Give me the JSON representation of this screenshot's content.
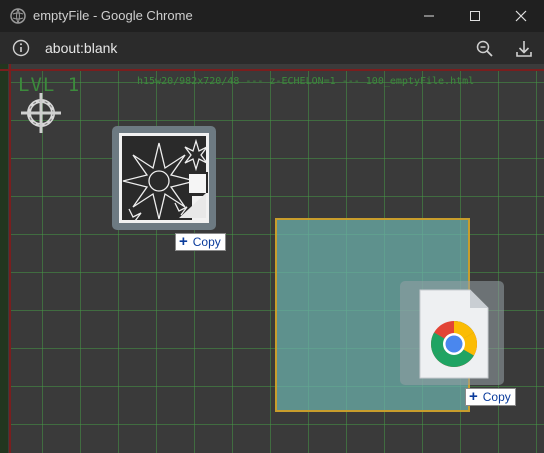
{
  "window": {
    "title": "emptyFile - Google Chrome"
  },
  "addressbar": {
    "url": "about:blank"
  },
  "page": {
    "level_label": "LVL 1",
    "debug_text": "h15w20/982x720/48 --- z-ECHELON=1 --- 100_emptyFile.html"
  },
  "badges": {
    "copy_label_1": "Copy",
    "copy_label_2": "Copy"
  },
  "colors": {
    "grid": "#469646",
    "drop_zone": "#6cb3ad",
    "drop_border": "#c89d2c",
    "copy_text": "#0b3c9c"
  }
}
